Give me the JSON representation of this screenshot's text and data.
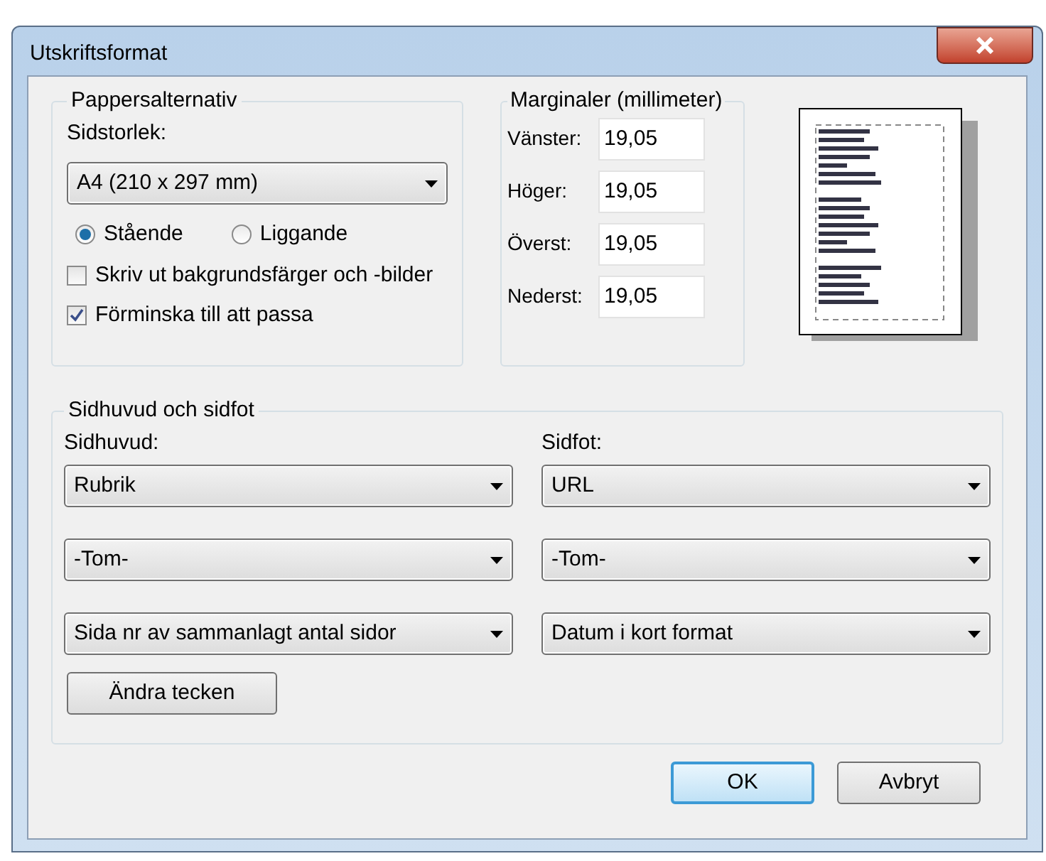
{
  "window": {
    "title": "Utskriftsformat"
  },
  "paper": {
    "legend": "Pappersalternativ",
    "size_label": "Sidstorlek:",
    "size_value": "A4 (210 x 297 mm)",
    "orientations": [
      {
        "label": "Stående",
        "selected": true
      },
      {
        "label": "Liggande",
        "selected": false
      }
    ],
    "options": [
      {
        "label": "Skriv ut bakgrundsfärger och -bilder",
        "checked": false
      },
      {
        "label": "Förminska till att passa",
        "checked": true
      }
    ]
  },
  "margins": {
    "legend": "Marginaler (millimeter)",
    "fields": [
      {
        "label": "Vänster:",
        "value": "19,05"
      },
      {
        "label": "Höger:",
        "value": "19,05"
      },
      {
        "label": "Överst:",
        "value": "19,05"
      },
      {
        "label": "Nederst:",
        "value": "19,05"
      }
    ]
  },
  "header_footer": {
    "legend": "Sidhuvud och sidfot",
    "columns": [
      {
        "label": "Sidhuvud:",
        "dropdowns": [
          "Rubrik",
          "-Tom-",
          "Sida nr av sammanlagt antal sidor"
        ]
      },
      {
        "label": "Sidfot:",
        "dropdowns": [
          "URL",
          "-Tom-",
          "Datum i kort format"
        ]
      }
    ],
    "font_button": "Ändra tecken"
  },
  "buttons": [
    {
      "label": "OK",
      "default": true
    },
    {
      "label": "Avbryt",
      "default": false
    }
  ]
}
